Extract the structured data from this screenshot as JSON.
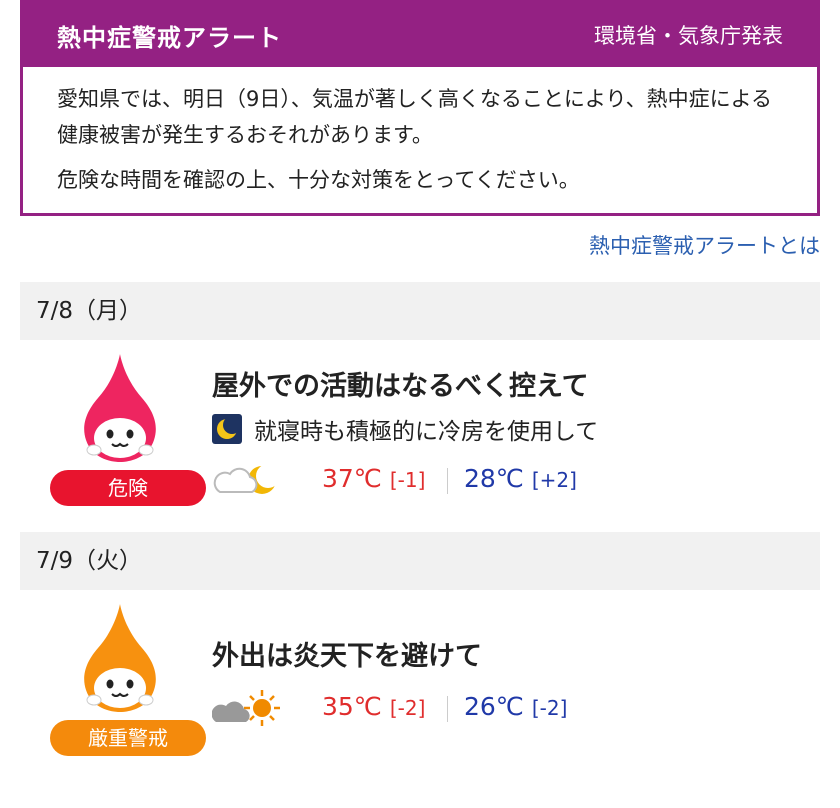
{
  "alert": {
    "title": "熱中症警戒アラート",
    "source": "環境省・気象庁発表",
    "body_line1": "愛知県では、明日（9日）、気温が著しく高くなることにより、熱中症による健康被害が発生するおそれがあります。",
    "body_line2": "危険な時間を確認の上、十分な対策をとってください。",
    "about_link": "熱中症警戒アラートとは"
  },
  "days": [
    {
      "date": "7/8（月）",
      "level": "危険",
      "level_color": "#e8142e",
      "mascot_color": "#ee2560",
      "advice": "屋外での活動はなるべく控えて",
      "sub_advice": "就寝時も積極的に冷房を使用して",
      "weather_icon": "cloudy-night-icon",
      "max_temp": "37℃",
      "max_diff": "[-1]",
      "min_temp": "28℃",
      "min_diff": "[+2]"
    },
    {
      "date": "7/9（火）",
      "level": "厳重警戒",
      "level_color": "#f48a0c",
      "mascot_color": "#f7910f",
      "advice": "外出は炎天下を避けて",
      "weather_icon": "cloudy-sunny-icon",
      "max_temp": "35℃",
      "max_diff": "[-2]",
      "min_temp": "26℃",
      "min_diff": "[-2]"
    }
  ],
  "colors": {
    "alert_purple": "#942183",
    "link_blue": "#2b5fb0",
    "max_red": "#e02d2d",
    "min_blue": "#2039a8"
  }
}
